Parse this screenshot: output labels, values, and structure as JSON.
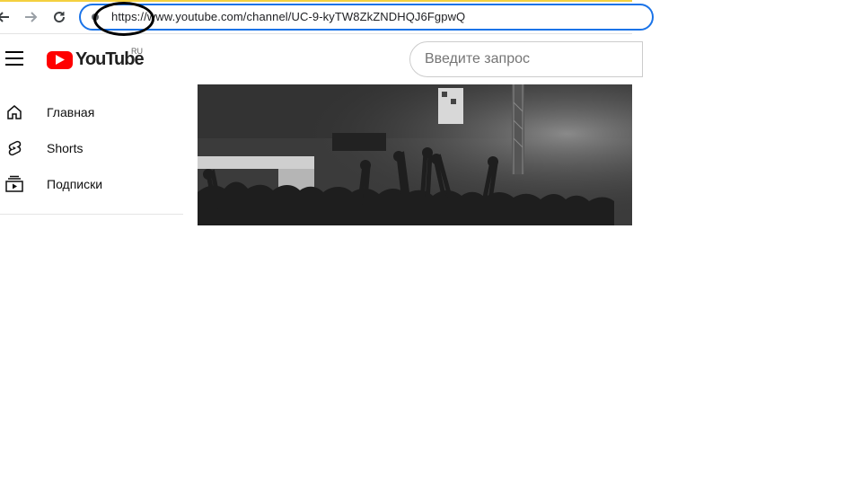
{
  "browser": {
    "url": "https://www.youtube.com/channel/UC-9-kyTW8ZkZNDHQJ6FgpwQ",
    "icons": [
      "back-arrow-icon",
      "forward-arrow-icon",
      "reload-icon",
      "site-info-icon"
    ]
  },
  "header": {
    "logo_text": "YouTube",
    "country_code": "RU",
    "search_placeholder": "Введите запрос"
  },
  "sidebar": {
    "items": [
      {
        "label": "Главная",
        "icon": "home-icon"
      },
      {
        "label": "Shorts",
        "icon": "shorts-icon"
      },
      {
        "label": "Подписки",
        "icon": "subscriptions-icon"
      }
    ]
  },
  "colors": {
    "brand_red": "#ff0000",
    "address_focus": "#1a73e8",
    "banner": "#3a3a3a"
  }
}
